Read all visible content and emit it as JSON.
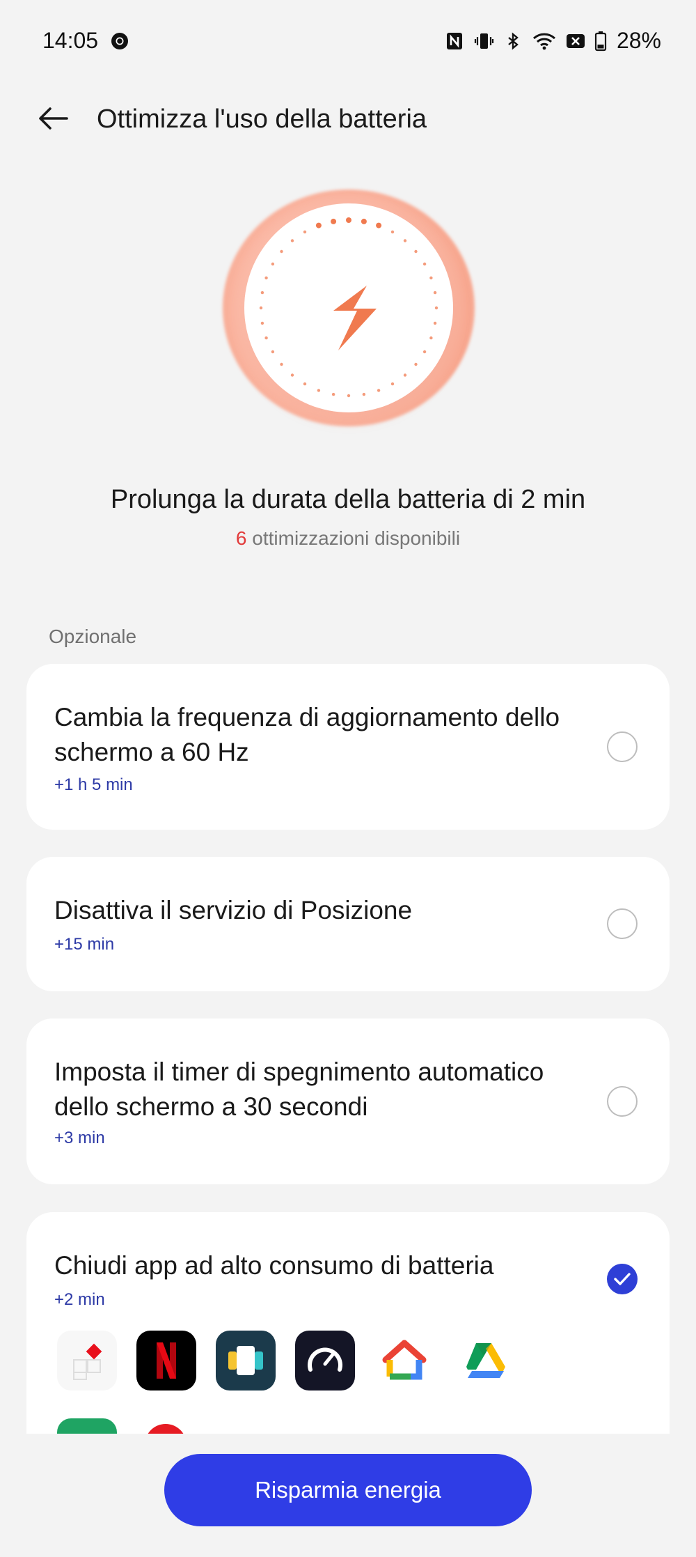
{
  "status_bar": {
    "time": "14:05",
    "battery_percent": "28%",
    "icons": [
      "chrome-icon",
      "nfc-icon",
      "vibrate-icon",
      "bluetooth-icon",
      "wifi-icon",
      "no-sim-icon",
      "battery-icon"
    ]
  },
  "header": {
    "title": "Ottimizza l'uso della batteria",
    "back_icon": "arrow-left-icon"
  },
  "hero": {
    "icon": "lightning-bolt-icon",
    "accent_color": "#f07a4f"
  },
  "summary": {
    "headline": "Prolunga la durata della batteria di 2 min",
    "count": "6",
    "count_suffix": " ottimizzazioni disponibili"
  },
  "section": {
    "label": "Opzionale"
  },
  "options": [
    {
      "title": "Cambia la frequenza di aggiornamento dello schermo a 60 Hz",
      "gain": "+1 h 5 min",
      "checked": false
    },
    {
      "title": "Disattiva il servizio di Posizione",
      "gain": "+15 min",
      "checked": false
    },
    {
      "title": "Imposta il timer di spegnimento automatico dello schermo a 30 secondi",
      "gain": "+3 min",
      "checked": false
    },
    {
      "title": "Chiudi app ad alto consumo di batteria",
      "gain": "+2 min",
      "checked": true,
      "apps": [
        "shapes-app-icon",
        "netflix-icon",
        "stack-app-icon",
        "speedtest-icon",
        "google-home-icon",
        "google-drive-icon"
      ]
    }
  ],
  "action": {
    "label": "Risparmia energia",
    "color": "#2f3de6"
  }
}
